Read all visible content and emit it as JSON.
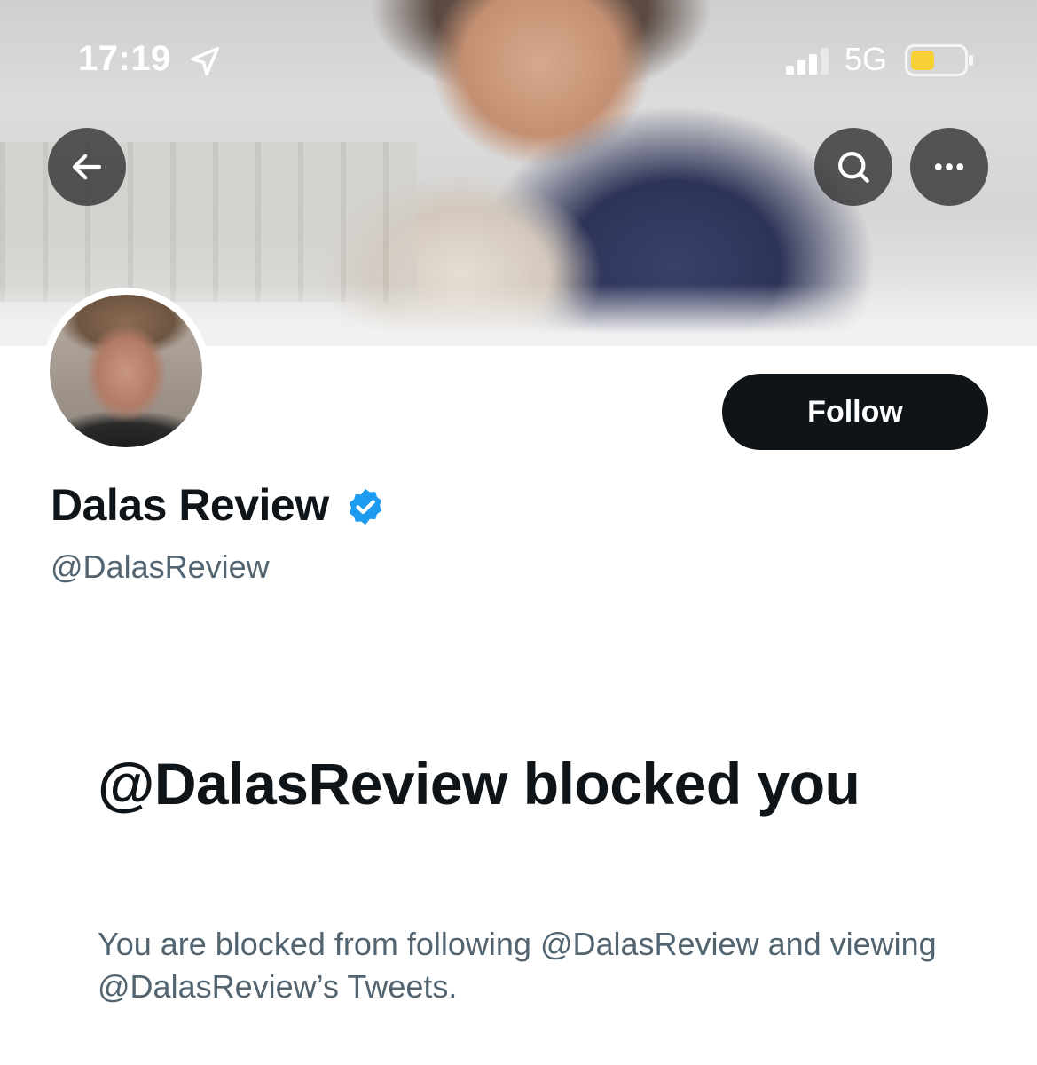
{
  "status_bar": {
    "time": "17:19",
    "network": "5G",
    "icons": [
      "location-arrow-icon",
      "signal-bars-icon",
      "battery-icon"
    ],
    "battery_color": "#f7d038"
  },
  "header": {
    "icons": {
      "back": "arrow-left-icon",
      "search": "search-icon",
      "more": "ellipsis-icon"
    }
  },
  "profile": {
    "display_name": "Dalas Review",
    "handle": "@DalasReview",
    "verified": true,
    "verified_color": "#1d9bf0",
    "follow_label": "Follow"
  },
  "blocked_notice": {
    "title": "@DalasReview blocked you",
    "body": "You are blocked from following @DalasReview and viewing @DalasReview’s Tweets."
  }
}
